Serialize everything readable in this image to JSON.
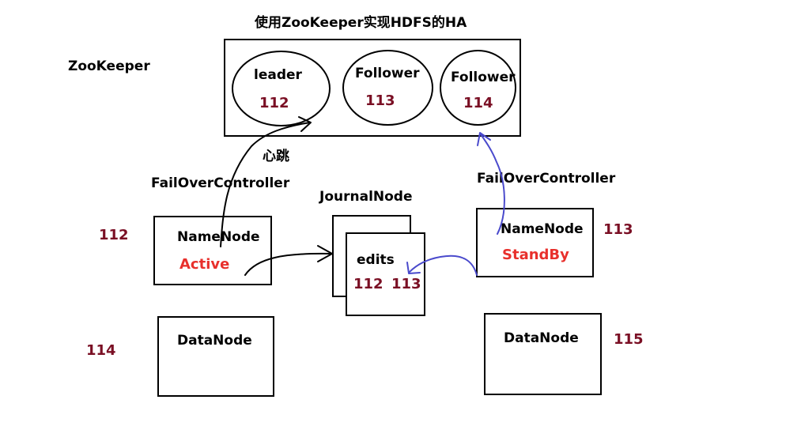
{
  "title": "使用ZooKeeper实现HDFS的HA",
  "zookeeper_label": "ZooKeeper",
  "zk_nodes": [
    {
      "role": "leader",
      "id": "112"
    },
    {
      "role": "Follower",
      "id": "113"
    },
    {
      "role": "Follower",
      "id": "114"
    }
  ],
  "heartbeat_label": "心跳",
  "left_controller": "FailOverController",
  "right_controller": "FailOverController",
  "journal": {
    "label": "JournalNode",
    "edits": "edits",
    "ids": [
      "112",
      "113"
    ]
  },
  "namenode_active": {
    "label": "NameNode",
    "state": "Active",
    "host": "112"
  },
  "namenode_standby": {
    "label": "NameNode",
    "state": "StandBy",
    "host": "113"
  },
  "datanode_left": {
    "label": "DataNode",
    "host": "114"
  },
  "datanode_right": {
    "label": "DataNode",
    "host": "115"
  },
  "colors": {
    "text": "#000000",
    "host_id": "#7a0f24",
    "state": "#e8302c",
    "standby_arrow": "#4a4acc"
  }
}
